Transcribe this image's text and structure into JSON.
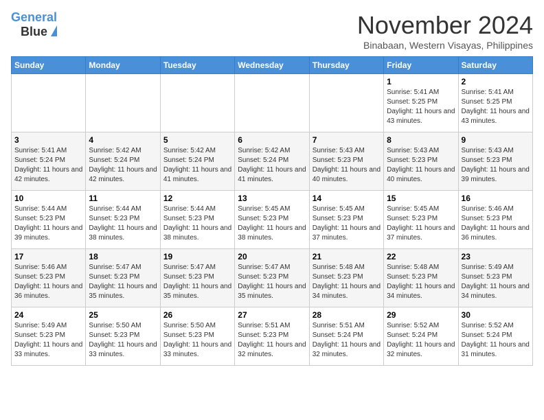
{
  "header": {
    "logo_line1": "General",
    "logo_line2": "Blue",
    "month_title": "November 2024",
    "location": "Binabaan, Western Visayas, Philippines"
  },
  "weekdays": [
    "Sunday",
    "Monday",
    "Tuesday",
    "Wednesday",
    "Thursday",
    "Friday",
    "Saturday"
  ],
  "weeks": [
    [
      {
        "day": "",
        "info": ""
      },
      {
        "day": "",
        "info": ""
      },
      {
        "day": "",
        "info": ""
      },
      {
        "day": "",
        "info": ""
      },
      {
        "day": "",
        "info": ""
      },
      {
        "day": "1",
        "info": "Sunrise: 5:41 AM\nSunset: 5:25 PM\nDaylight: 11 hours\nand 43 minutes."
      },
      {
        "day": "2",
        "info": "Sunrise: 5:41 AM\nSunset: 5:25 PM\nDaylight: 11 hours\nand 43 minutes."
      }
    ],
    [
      {
        "day": "3",
        "info": "Sunrise: 5:41 AM\nSunset: 5:24 PM\nDaylight: 11 hours\nand 42 minutes."
      },
      {
        "day": "4",
        "info": "Sunrise: 5:42 AM\nSunset: 5:24 PM\nDaylight: 11 hours\nand 42 minutes."
      },
      {
        "day": "5",
        "info": "Sunrise: 5:42 AM\nSunset: 5:24 PM\nDaylight: 11 hours\nand 41 minutes."
      },
      {
        "day": "6",
        "info": "Sunrise: 5:42 AM\nSunset: 5:24 PM\nDaylight: 11 hours\nand 41 minutes."
      },
      {
        "day": "7",
        "info": "Sunrise: 5:43 AM\nSunset: 5:23 PM\nDaylight: 11 hours\nand 40 minutes."
      },
      {
        "day": "8",
        "info": "Sunrise: 5:43 AM\nSunset: 5:23 PM\nDaylight: 11 hours\nand 40 minutes."
      },
      {
        "day": "9",
        "info": "Sunrise: 5:43 AM\nSunset: 5:23 PM\nDaylight: 11 hours\nand 39 minutes."
      }
    ],
    [
      {
        "day": "10",
        "info": "Sunrise: 5:44 AM\nSunset: 5:23 PM\nDaylight: 11 hours\nand 39 minutes."
      },
      {
        "day": "11",
        "info": "Sunrise: 5:44 AM\nSunset: 5:23 PM\nDaylight: 11 hours\nand 38 minutes."
      },
      {
        "day": "12",
        "info": "Sunrise: 5:44 AM\nSunset: 5:23 PM\nDaylight: 11 hours\nand 38 minutes."
      },
      {
        "day": "13",
        "info": "Sunrise: 5:45 AM\nSunset: 5:23 PM\nDaylight: 11 hours\nand 38 minutes."
      },
      {
        "day": "14",
        "info": "Sunrise: 5:45 AM\nSunset: 5:23 PM\nDaylight: 11 hours\nand 37 minutes."
      },
      {
        "day": "15",
        "info": "Sunrise: 5:45 AM\nSunset: 5:23 PM\nDaylight: 11 hours\nand 37 minutes."
      },
      {
        "day": "16",
        "info": "Sunrise: 5:46 AM\nSunset: 5:23 PM\nDaylight: 11 hours\nand 36 minutes."
      }
    ],
    [
      {
        "day": "17",
        "info": "Sunrise: 5:46 AM\nSunset: 5:23 PM\nDaylight: 11 hours\nand 36 minutes."
      },
      {
        "day": "18",
        "info": "Sunrise: 5:47 AM\nSunset: 5:23 PM\nDaylight: 11 hours\nand 35 minutes."
      },
      {
        "day": "19",
        "info": "Sunrise: 5:47 AM\nSunset: 5:23 PM\nDaylight: 11 hours\nand 35 minutes."
      },
      {
        "day": "20",
        "info": "Sunrise: 5:47 AM\nSunset: 5:23 PM\nDaylight: 11 hours\nand 35 minutes."
      },
      {
        "day": "21",
        "info": "Sunrise: 5:48 AM\nSunset: 5:23 PM\nDaylight: 11 hours\nand 34 minutes."
      },
      {
        "day": "22",
        "info": "Sunrise: 5:48 AM\nSunset: 5:23 PM\nDaylight: 11 hours\nand 34 minutes."
      },
      {
        "day": "23",
        "info": "Sunrise: 5:49 AM\nSunset: 5:23 PM\nDaylight: 11 hours\nand 34 minutes."
      }
    ],
    [
      {
        "day": "24",
        "info": "Sunrise: 5:49 AM\nSunset: 5:23 PM\nDaylight: 11 hours\nand 33 minutes."
      },
      {
        "day": "25",
        "info": "Sunrise: 5:50 AM\nSunset: 5:23 PM\nDaylight: 11 hours\nand 33 minutes."
      },
      {
        "day": "26",
        "info": "Sunrise: 5:50 AM\nSunset: 5:23 PM\nDaylight: 11 hours\nand 33 minutes."
      },
      {
        "day": "27",
        "info": "Sunrise: 5:51 AM\nSunset: 5:23 PM\nDaylight: 11 hours\nand 32 minutes."
      },
      {
        "day": "28",
        "info": "Sunrise: 5:51 AM\nSunset: 5:24 PM\nDaylight: 11 hours\nand 32 minutes."
      },
      {
        "day": "29",
        "info": "Sunrise: 5:52 AM\nSunset: 5:24 PM\nDaylight: 11 hours\nand 32 minutes."
      },
      {
        "day": "30",
        "info": "Sunrise: 5:52 AM\nSunset: 5:24 PM\nDaylight: 11 hours\nand 31 minutes."
      }
    ]
  ]
}
